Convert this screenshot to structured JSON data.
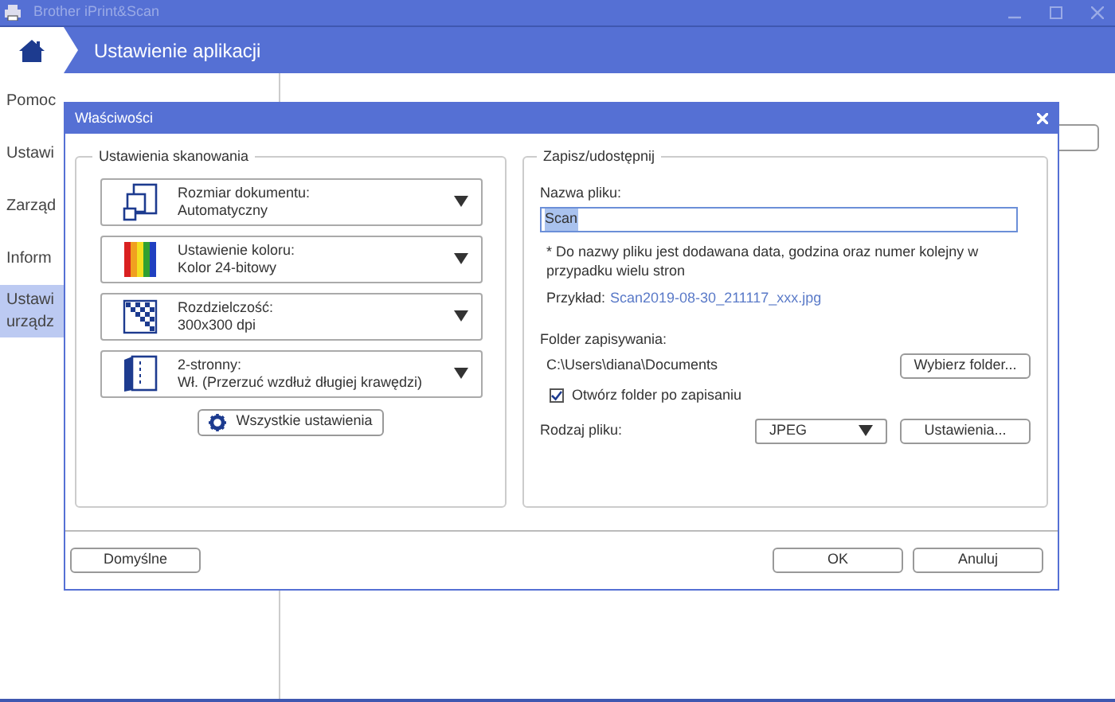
{
  "app_window": {
    "title": "Brother iPrint&Scan"
  },
  "header": {
    "title": "Ustawienie aplikacji"
  },
  "sidebar": {
    "items": [
      {
        "label": "Pomoc",
        "selected": false
      },
      {
        "label": "Ustawi",
        "selected": false
      },
      {
        "label": "Zarząd",
        "selected": false
      },
      {
        "label": "Inform",
        "selected": false
      },
      {
        "label": "Ustawi\nurządz",
        "selected": true
      }
    ]
  },
  "dialog": {
    "title": "Właściwości",
    "scan_settings": {
      "title": "Ustawienia skanowania",
      "dropdowns": [
        {
          "kind": "size",
          "label": "Rozmiar dokumentu:",
          "value": "Automatyczny"
        },
        {
          "kind": "color",
          "label": "Ustawienie koloru:",
          "value": "Kolor 24-bitowy"
        },
        {
          "kind": "resolution",
          "label": "Rozdzielczość:",
          "value": "300x300 dpi"
        },
        {
          "kind": "duplex",
          "label": "2-stronny:",
          "value": "Wł. (Przerzuć wzdłuż długiej krawędzi)"
        }
      ],
      "all_settings_button": "Wszystkie ustawienia"
    },
    "save_share": {
      "title": "Zapisz/udostępnij",
      "file_name_label": "Nazwa pliku:",
      "file_name": "Scan",
      "file_name_selected": true,
      "note": "* Do nazwy pliku jest dodawana data, godzina oraz numer kolejny w przypadku wielu stron",
      "example_label": "Przykład:",
      "example": "Scan2019-08-30_211117_xxx.jpg",
      "folder_label": "Folder zapisywania:",
      "folder_path": "C:\\Users\\diana\\Documents",
      "choose_folder_button": "Wybierz folder...",
      "open_folder": {
        "label": "Otwórz folder po zapisaniu",
        "checked": true
      },
      "file_type_label": "Rodzaj pliku:",
      "file_type": "JPEG",
      "settings_button": "Ustawienia..."
    },
    "footer": {
      "default_button": "Domyślne",
      "ok_button": "OK",
      "cancel_button": "Anuluj"
    }
  }
}
